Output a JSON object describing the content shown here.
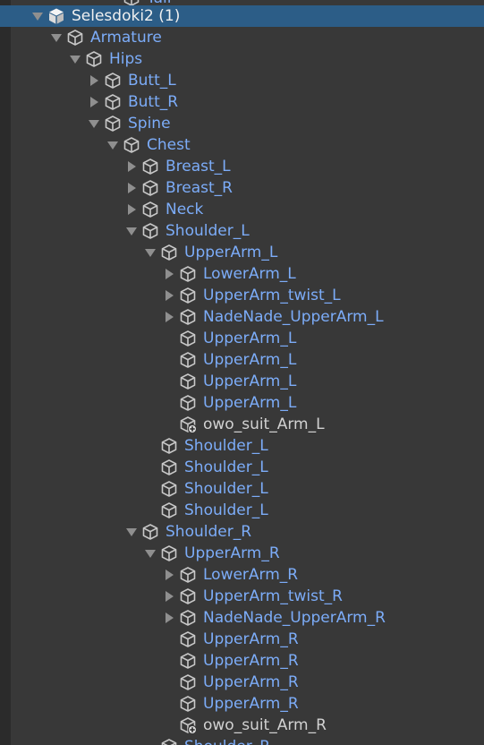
{
  "hierarchy": {
    "root": {
      "label": "Selesdoki2 (1)"
    },
    "items": [
      {
        "label": "Tail"
      },
      {
        "label": "Armature"
      },
      {
        "label": "Hips"
      },
      {
        "label": "Butt_L"
      },
      {
        "label": "Butt_R"
      },
      {
        "label": "Spine"
      },
      {
        "label": "Chest"
      },
      {
        "label": "Breast_L"
      },
      {
        "label": "Breast_R"
      },
      {
        "label": "Neck"
      },
      {
        "label": "Shoulder_L"
      },
      {
        "label": "UpperArm_L"
      },
      {
        "label": "LowerArm_L"
      },
      {
        "label": "UpperArm_twist_L"
      },
      {
        "label": "NadeNade_UpperArm_L"
      },
      {
        "label": "UpperArm_L"
      },
      {
        "label": "UpperArm_L"
      },
      {
        "label": "UpperArm_L"
      },
      {
        "label": "UpperArm_L"
      },
      {
        "label": "owo_suit_Arm_L"
      },
      {
        "label": "Shoulder_L"
      },
      {
        "label": "Shoulder_L"
      },
      {
        "label": "Shoulder_L"
      },
      {
        "label": "Shoulder_L"
      },
      {
        "label": "Shoulder_R"
      },
      {
        "label": "UpperArm_R"
      },
      {
        "label": "LowerArm_R"
      },
      {
        "label": "UpperArm_twist_R"
      },
      {
        "label": "NadeNade_UpperArm_R"
      },
      {
        "label": "UpperArm_R"
      },
      {
        "label": "UpperArm_R"
      },
      {
        "label": "UpperArm_R"
      },
      {
        "label": "UpperArm_R"
      },
      {
        "label": "owo_suit_Arm_R"
      },
      {
        "label": "Shoulder_R"
      }
    ]
  },
  "colors": {
    "background": "#383838",
    "selection": "#2c5d87",
    "prefab_text": "#7cacf8",
    "plain_text": "#d2d2d2",
    "arrow": "#8f8f8f"
  },
  "icons": {
    "prefab": "cube-icon",
    "root_prefab": "filled-cube-icon",
    "added_object": "cube-with-plus-icon",
    "expanded": "triangle-down-icon",
    "collapsed": "triangle-right-icon"
  }
}
